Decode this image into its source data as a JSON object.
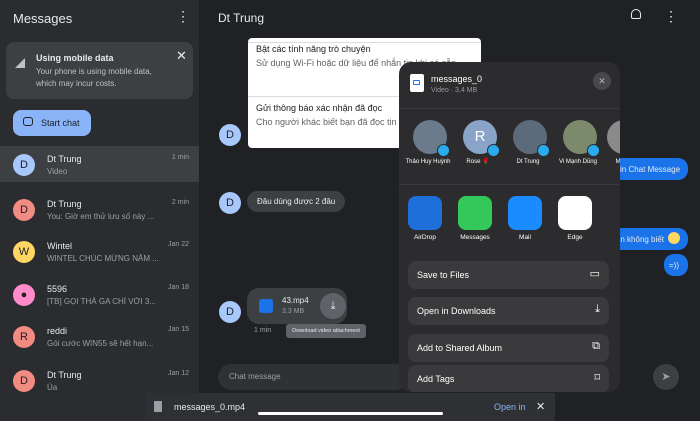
{
  "sidebar": {
    "title": "Messages",
    "banner": {
      "title": "Using mobile data",
      "description": "Your phone is using mobile data, which may incur costs."
    },
    "start_chat_label": "Start chat",
    "conversations": [
      {
        "initial": "D",
        "name": "Dt Trung",
        "preview": "Video",
        "time": "1 min",
        "color": "#a8c7fa"
      },
      {
        "initial": "D",
        "name": "Dt Trung",
        "preview": "You: Giờ em thử lưu số này ...",
        "time": "2 min",
        "color": "#f28b82"
      },
      {
        "initial": "W",
        "name": "Wintel",
        "preview": "WINTEL CHÚC MỪNG NĂM ...",
        "time": "Jan 22",
        "color": "#fdd663"
      },
      {
        "initial": "",
        "name": "5596",
        "preview": "[TB] GỌI THẢ GA CHỈ VỚI 3...",
        "time": "Jan 18",
        "color": "#ff8bcb"
      },
      {
        "initial": "R",
        "name": "reddi",
        "preview": "Gói cước WIN55 sẽ hết hạn...",
        "time": "Jan 15",
        "color": "#f28b82"
      },
      {
        "initial": "D",
        "name": "Dt Trung",
        "preview": "Ùa",
        "time": "Jan 12",
        "color": "#f28b82"
      }
    ]
  },
  "thread": {
    "title": "Dt Trung",
    "settings": [
      {
        "title": "Bật các tính năng trò chuyện",
        "desc": "Sử dụng Wi-Fi hoặc dữ liệu để nhắn tin khi có sẵn"
      },
      {
        "title": "Gửi thông báo xác nhận đã đọc",
        "desc": "Cho người khác biết bạn đã đọc tin nhắn của họ"
      }
    ],
    "message_text": "Đâu dùng được 2 đâu",
    "file": {
      "name": "43.mp4",
      "size": "3.3 MB",
      "meta": "1 min"
    },
    "tooltip": "Download video attachment",
    "right_bubbles": [
      "in Chat Message",
      "Tin không biết",
      "=))"
    ],
    "input_placeholder": "Chat message"
  },
  "share_sheet": {
    "file_name": "messages_0",
    "file_meta": "Video · 3,4 MB",
    "contacts": [
      {
        "name": "Thảo Huy Huỳnh",
        "initial": "",
        "color": "#6b7b8c"
      },
      {
        "name": "Rose 🌹",
        "initial": "R",
        "color": "#8aa3c9"
      },
      {
        "name": "Dt Trung",
        "initial": "",
        "color": "#5c6b7a"
      },
      {
        "name": "Vi Mạnh Dũng",
        "initial": "",
        "color": "#7a8a6b"
      },
      {
        "name": "Mike",
        "initial": "",
        "color": "#8a8a8a"
      }
    ],
    "apps": [
      {
        "name": "AirDrop",
        "color": "#1e6fd9"
      },
      {
        "name": "Messages",
        "color": "#34c759"
      },
      {
        "name": "Mail",
        "color": "#1a8cff"
      },
      {
        "name": "Edge",
        "color": "#ffffff"
      }
    ],
    "actions": [
      {
        "label": "Save to Files",
        "icon": "▭"
      },
      {
        "label": "Open in Downloads",
        "icon": "⤓"
      },
      {
        "label": "Add to Shared Album",
        "icon": "⧉"
      },
      {
        "label": "Add Tags",
        "icon": "⌑"
      }
    ]
  },
  "download_bar": {
    "file_name": "messages_0.mp4",
    "open_in_label": "Open in"
  }
}
